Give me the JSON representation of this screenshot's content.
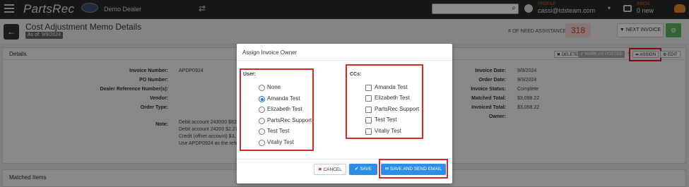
{
  "nav": {
    "brand": "PartsRec",
    "dealer": "Demo Dealer",
    "search_placeholder": "",
    "profile_label": "PROFILE",
    "profile_email": "cassi@tdsteam.com",
    "inbox_label": "INBOX",
    "inbox_count": "0 new"
  },
  "header": {
    "title": "Cost Adjustment Memo Details",
    "as_of": "As of: 9/9/2024",
    "need_label": "# OF NEED ASSISTANCE:",
    "need_count": "318",
    "next_label": "NEXT INVOICE"
  },
  "details": {
    "title": "Details",
    "actions": {
      "delete": "DELETE",
      "mark_posted": "MARK AS POSTED",
      "assign": "ASSIGN",
      "edit": "EDIT"
    },
    "left_fields": [
      {
        "label": "Invoice Number:",
        "value": "APDP0924"
      },
      {
        "label": "PO Number:",
        "value": ""
      },
      {
        "label": "Dealer Reference Number(s):",
        "value": ""
      },
      {
        "label": "Vendor:",
        "value": ""
      },
      {
        "label": "Order Type:",
        "value": ""
      }
    ],
    "note_label": "Note:",
    "note_lines": [
      "Debit account 243000 $82",
      "Debit account 24200 $2,27",
      "Credit (offset account) $3,",
      "Use APDP0924 as the refe"
    ],
    "right_fields": [
      {
        "label": "Invoice Date:",
        "value": "9/9/2024"
      },
      {
        "label": "Order Date:",
        "value": "9/9/2024"
      },
      {
        "label": "Invoice Status:",
        "value": "Complete"
      },
      {
        "label": "Matched Total:",
        "value": "$3,098.22"
      },
      {
        "label": "Invoiced Total:",
        "value": "$3,098.22"
      },
      {
        "label": "Owner:",
        "value": ""
      }
    ]
  },
  "matched": {
    "title": "Matched Items"
  },
  "modal": {
    "title": "Assign Invoice Owner",
    "user_label": "User:",
    "users": [
      {
        "label": "None",
        "selected": false
      },
      {
        "label": "Amanda Test",
        "selected": true
      },
      {
        "label": "Elizabeth Test",
        "selected": false
      },
      {
        "label": "PartsRec Support",
        "selected": false
      },
      {
        "label": "Test Test",
        "selected": false
      },
      {
        "label": "Vitaliy Test",
        "selected": false
      }
    ],
    "cc_label": "CCs:",
    "ccs": [
      {
        "label": "Amanda Test",
        "checked": false
      },
      {
        "label": "Elizabeth Test",
        "checked": false
      },
      {
        "label": "PartsRec Support",
        "checked": false
      },
      {
        "label": "Test Test",
        "checked": false
      },
      {
        "label": "Vitaliy Test",
        "checked": false
      }
    ],
    "cancel_label": "CANCEL",
    "save_label": "SAVE",
    "send_label": "SAVE AND SEND EMAIL"
  },
  "colors": {
    "accent": "#2d8ee6",
    "highlight": "#d62828",
    "nav_bg": "#2b2b2b",
    "brand_orange": "#e06c2d"
  }
}
